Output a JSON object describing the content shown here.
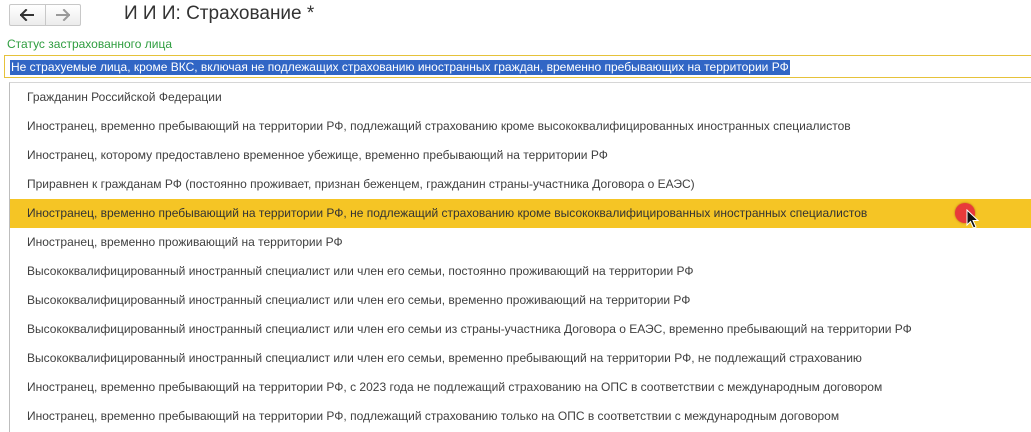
{
  "window": {
    "title": "И И И: Страхование *",
    "back_icon": "arrow-left-icon",
    "forward_icon": "arrow-right-icon"
  },
  "field": {
    "label": "Статус застрахованного лица",
    "value": "Не страхуемые лица, кроме ВКС, включая не подлежащих страхованию иностранных граждан, временно пребывающих на территории РФ"
  },
  "dropdown": {
    "selected_index": 4,
    "options": [
      {
        "label": "Гражданин Российской Федерации"
      },
      {
        "label": "Иностранец, временно пребывающий на территории РФ, подлежащий страхованию кроме высококвалифицированных иностранных специалистов"
      },
      {
        "label": "Иностранец, которому предоставлено временное убежище, временно пребывающий на территории РФ"
      },
      {
        "label": "Приравнен к гражданам РФ (постоянно проживает, признан беженцем, гражданин страны-участника Договора о ЕАЭС)"
      },
      {
        "label": "Иностранец, временно пребывающий на территории РФ, не подлежащий страхованию кроме высококвалифицированных иностранных специалистов"
      },
      {
        "label": "Иностранец, временно проживающий на территории РФ"
      },
      {
        "label": "Высококвалифицированный иностранный специалист или член его семьи, постоянно проживающий на территории РФ"
      },
      {
        "label": "Высококвалифицированный иностранный специалист или член его семьи, временно проживающий на территории РФ"
      },
      {
        "label": "Высококвалифицированный иностранный специалист или член его семьи из страны-участника Договора о ЕАЭС, временно пребывающий на территории РФ"
      },
      {
        "label": "Высококвалифицированный иностранный специалист или член его семьи, временно пребывающий на территории РФ, не подлежащий страхованию"
      },
      {
        "label": "Иностранец, временно пребывающий на территории РФ, с 2023 года не подлежащий страхованию на ОПС в соответствии с международным договором"
      },
      {
        "label": "Иностранец, временно пребывающий на территории РФ, подлежащий страхованию только на ОПС в соответствии с международным договором"
      }
    ]
  },
  "colors": {
    "accent_selected": "#f5c525",
    "field_label": "#2e9d3f",
    "text_selection": "#3166c5",
    "click_marker": "#e83a3a"
  }
}
